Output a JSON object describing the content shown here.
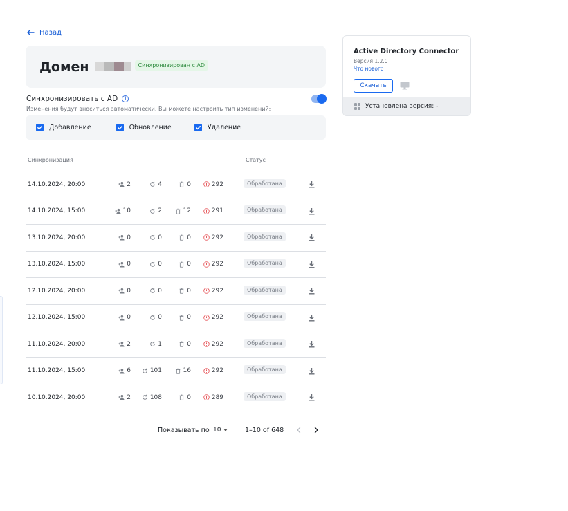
{
  "nav": {
    "back_label": "Назад"
  },
  "domain": {
    "title": "Домен",
    "badge": "Синхронизирован с AD"
  },
  "sync": {
    "title": "Синхронизировать с AD",
    "description": "Изменения будут вноситься автоматически. Вы можете настроить тип изменений:",
    "enabled": true,
    "options": [
      {
        "label": "Добавление",
        "checked": true
      },
      {
        "label": "Обновление",
        "checked": true
      },
      {
        "label": "Удаление",
        "checked": true
      }
    ]
  },
  "table": {
    "headers": {
      "sync": "Синхронизация",
      "status": "Статус"
    },
    "rows": [
      {
        "date": "14.10.2024, 20:00",
        "added": "2",
        "updated": "4",
        "deleted": "0",
        "errors": "292",
        "status": "Обработана"
      },
      {
        "date": "14.10.2024, 15:00",
        "added": "10",
        "updated": "2",
        "deleted": "12",
        "errors": "291",
        "status": "Обработана"
      },
      {
        "date": "13.10.2024, 20:00",
        "added": "0",
        "updated": "0",
        "deleted": "0",
        "errors": "292",
        "status": "Обработана"
      },
      {
        "date": "13.10.2024, 15:00",
        "added": "0",
        "updated": "0",
        "deleted": "0",
        "errors": "292",
        "status": "Обработана"
      },
      {
        "date": "12.10.2024, 20:00",
        "added": "0",
        "updated": "0",
        "deleted": "0",
        "errors": "292",
        "status": "Обработана"
      },
      {
        "date": "12.10.2024, 15:00",
        "added": "0",
        "updated": "0",
        "deleted": "0",
        "errors": "292",
        "status": "Обработана"
      },
      {
        "date": "11.10.2024, 20:00",
        "added": "2",
        "updated": "1",
        "deleted": "0",
        "errors": "292",
        "status": "Обработана"
      },
      {
        "date": "11.10.2024, 15:00",
        "added": "6",
        "updated": "101",
        "deleted": "16",
        "errors": "292",
        "status": "Обработана"
      },
      {
        "date": "10.10.2024, 20:00",
        "added": "2",
        "updated": "108",
        "deleted": "0",
        "errors": "289",
        "status": "Обработана"
      }
    ]
  },
  "pagination": {
    "rows_label": "Показывать по",
    "page_size": "10",
    "range": "1–10 of 648"
  },
  "connector": {
    "title": "Active Directory Connector",
    "version": "Версия 1.2.0",
    "whats_new": "Что нового",
    "download_label": "Скачать",
    "installed_label": "Установлена версия: -"
  },
  "icons": {
    "back": "arrow-left-icon",
    "info": "info-icon",
    "added": "user-plus-icon",
    "updated": "refresh-icon",
    "deleted": "trash-icon",
    "errors": "error-circle-icon",
    "download": "download-icon",
    "monitor": "monitor-icon",
    "installed": "grid-icon",
    "prev": "chevron-left-icon",
    "next": "chevron-right-icon"
  },
  "colors": {
    "accent": "#1a6af0",
    "success_bg": "#e4f6e7",
    "success_text": "#2e8b3e",
    "error": "#e5484d"
  }
}
